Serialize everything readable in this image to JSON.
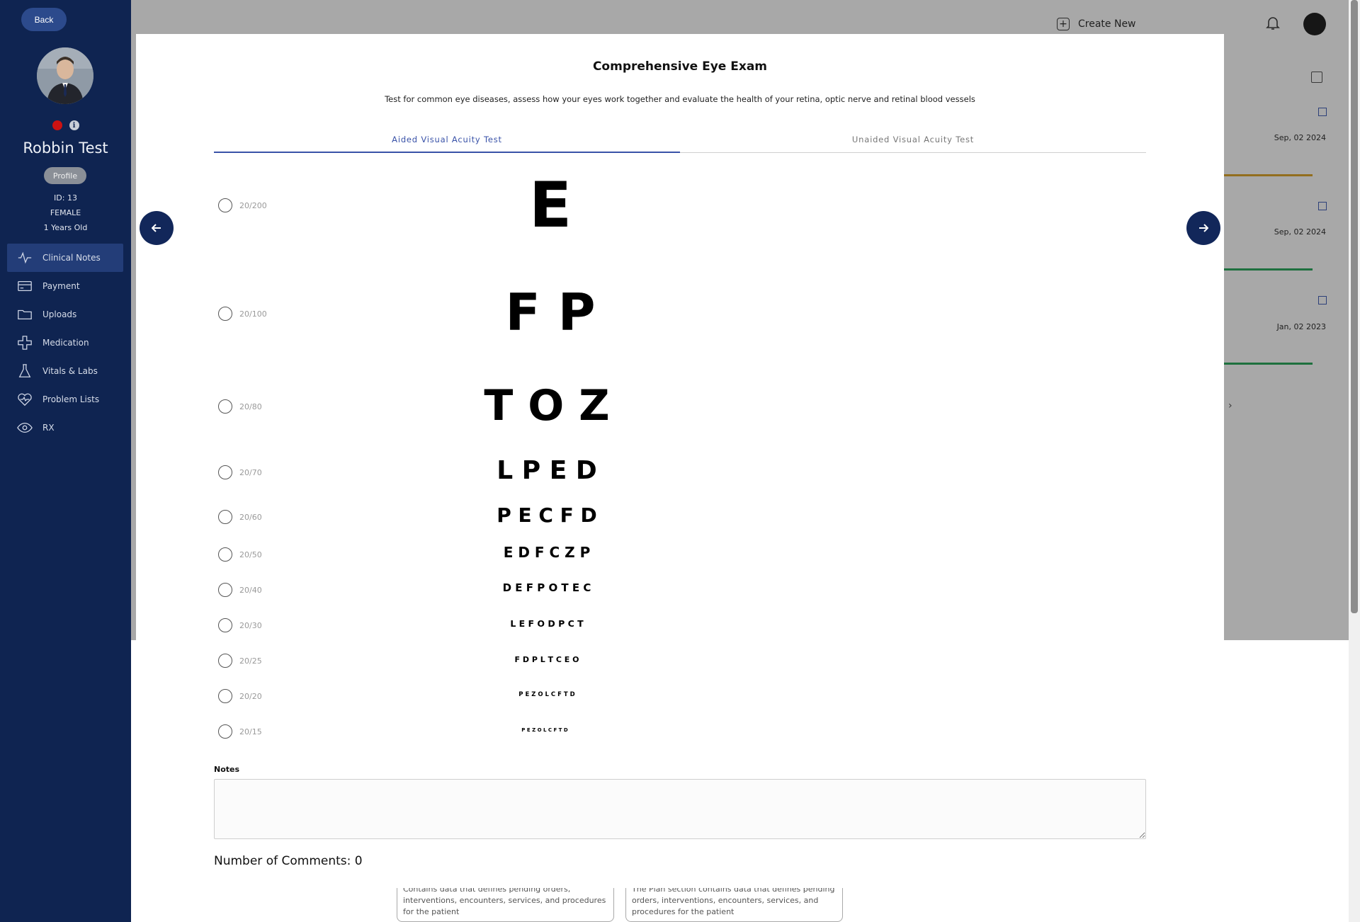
{
  "sidebar": {
    "back_label": "Back",
    "patient_name": "Robbin Test",
    "profile_label": "Profile",
    "id_text": "ID: 13",
    "gender": "FEMALE",
    "age": "1 Years Old",
    "items": [
      {
        "label": "Clinical Notes",
        "icon": "activity-icon",
        "active": true
      },
      {
        "label": "Payment",
        "icon": "card-icon"
      },
      {
        "label": "Uploads",
        "icon": "folder-icon"
      },
      {
        "label": "Medication",
        "icon": "medical-cross-icon"
      },
      {
        "label": "Vitals & Labs",
        "icon": "flask-icon"
      },
      {
        "label": "Problem Lists",
        "icon": "heart-pulse-icon"
      },
      {
        "label": "RX",
        "icon": "eye-icon"
      }
    ]
  },
  "header": {
    "create_new_label": "Create New"
  },
  "cards": [
    {
      "date": "Sep, 02 2024",
      "bar_color": "#e0a82e"
    },
    {
      "date": "Sep, 02 2024",
      "bar_color": "#2eaa5f"
    },
    {
      "date": "Jan, 02 2023",
      "bar_color": "#2eaa5f"
    }
  ],
  "lower_cards": [
    {
      "text": "Contains data that defines pending orders, interventions, encounters, services, and procedures for the patient"
    },
    {
      "text": "The Plan section contains data that defines pending orders, interventions, encounters, services, and procedures for the patient"
    }
  ],
  "modal": {
    "title": "Comprehensive Eye Exam",
    "subtitle": "Test for common eye diseases, assess how your eyes work together and evaluate the health of your retina, optic nerve and retinal blood vessels",
    "tabs": [
      {
        "label": "Aided Visual Acuity Test",
        "active": true
      },
      {
        "label": "Unaided Visual Acuity Test",
        "active": false
      }
    ],
    "chart_rows": [
      {
        "acuity": "20/200",
        "letters": "E"
      },
      {
        "acuity": "20/100",
        "letters": "F P"
      },
      {
        "acuity": "20/80",
        "letters": "T O Z"
      },
      {
        "acuity": "20/70",
        "letters": "L P E D"
      },
      {
        "acuity": "20/60",
        "letters": "P E C F D"
      },
      {
        "acuity": "20/50",
        "letters": "E D F C Z P"
      },
      {
        "acuity": "20/40",
        "letters": "D E F P O T E C"
      },
      {
        "acuity": "20/30",
        "letters": "L E F O D P C T"
      },
      {
        "acuity": "20/25",
        "letters": "F D P L T C E O"
      },
      {
        "acuity": "20/20",
        "letters": "P E Z O L C F T D"
      },
      {
        "acuity": "20/15",
        "letters": "P E Z O L C F T D"
      }
    ],
    "notes_label": "Notes",
    "notes_value": "",
    "comments_text": "Number of Comments: 0"
  }
}
